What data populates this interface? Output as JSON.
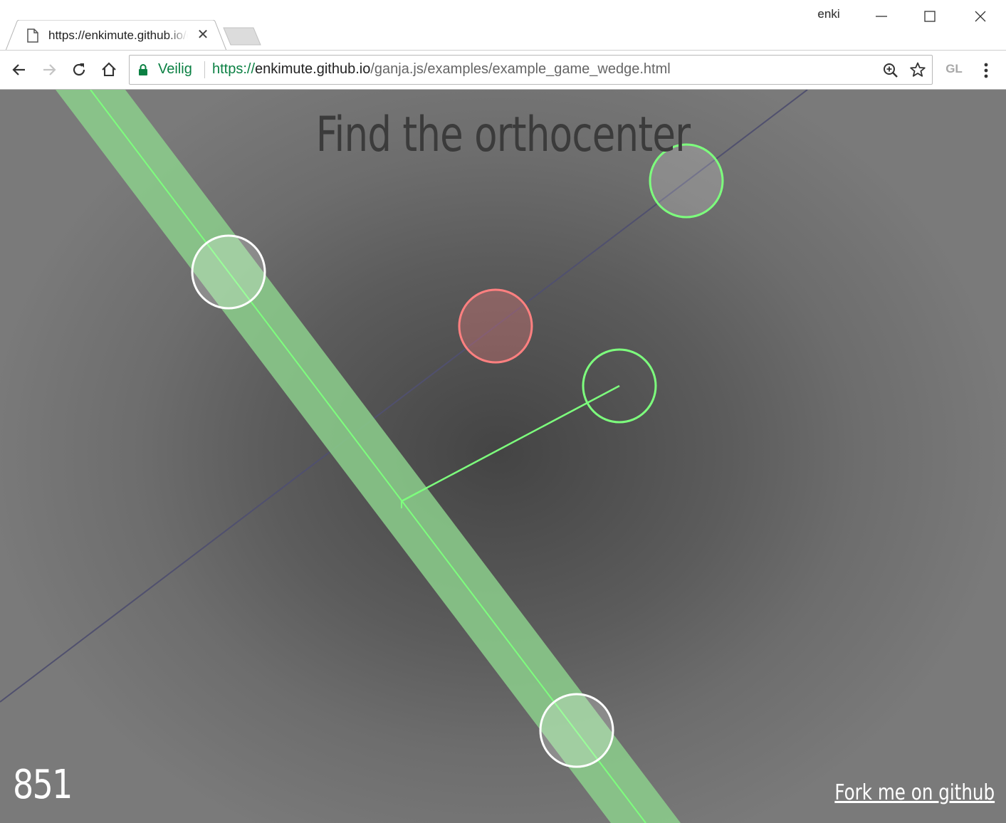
{
  "browser": {
    "profile_name": "enki",
    "tab": {
      "title": "https://enkimute.github.io/ganja.js/examples/example_game_wedge.html",
      "close_glyph": "✕",
      "favicon": "page-icon"
    },
    "omnibox": {
      "secure_label": "Veilig",
      "url_scheme": "https://",
      "url_host": "enkimute.github.io",
      "url_path": "/ganja.js/examples/example_game_wedge.html"
    },
    "extension_label": "GL",
    "icons": {
      "back": "arrow-left-icon",
      "forward": "arrow-right-icon",
      "reload": "reload-icon",
      "home": "home-icon",
      "lock": "lock-icon",
      "zoom": "zoom-icon",
      "bookmark": "star-icon",
      "menu": "kebab-menu-icon"
    },
    "colors": {
      "secure": "#0b8043"
    }
  },
  "game": {
    "title": "Find the orthocenter",
    "score": "851",
    "fork_link": "Fork me on github",
    "colors": {
      "line": "#7dff7d",
      "band": "#8ccf8c",
      "target": "#ff8080",
      "handle": "#ffffff",
      "axis": "#50506e"
    }
  }
}
